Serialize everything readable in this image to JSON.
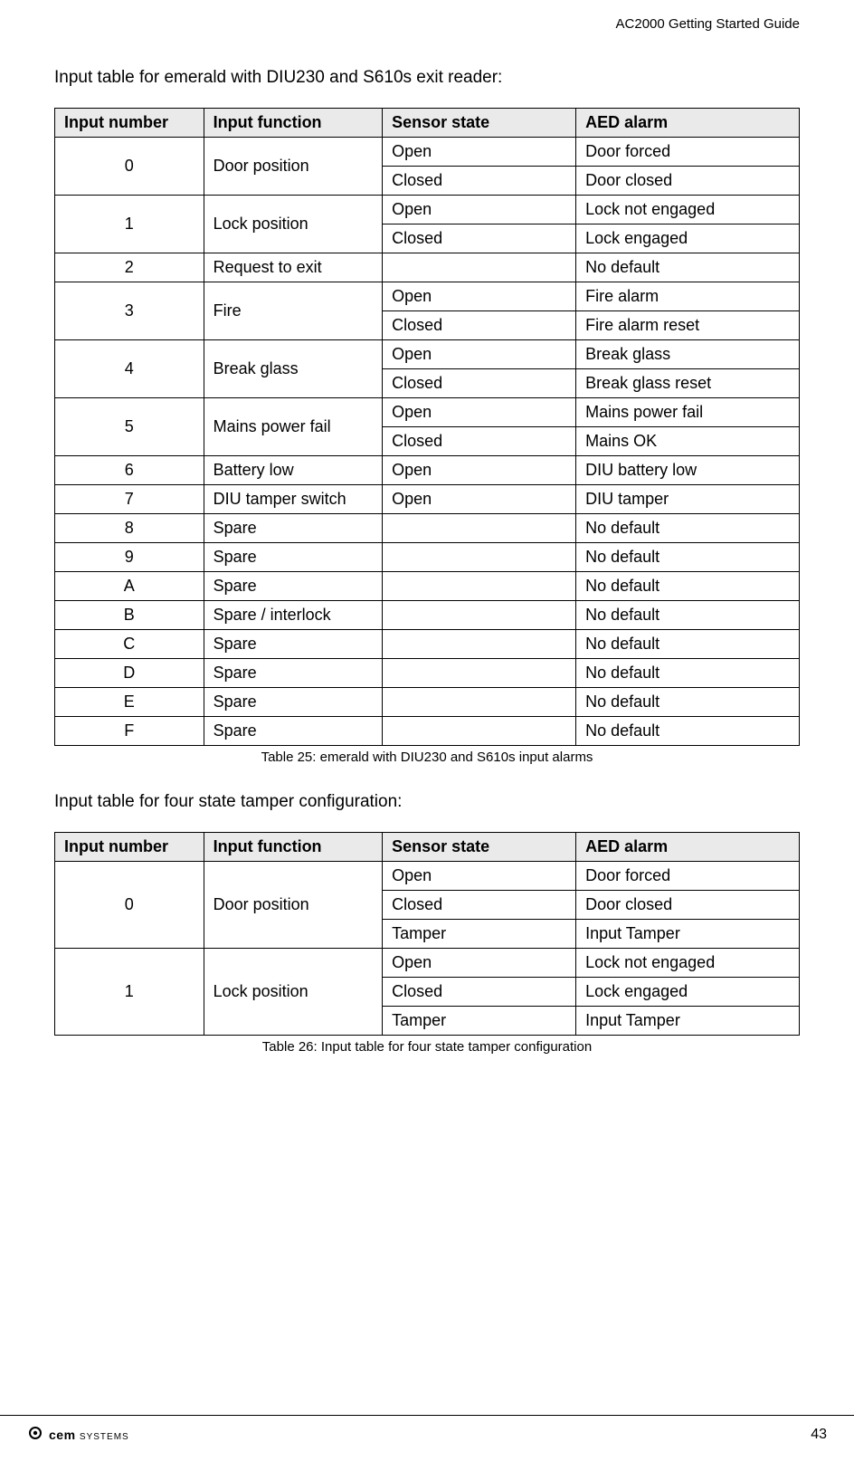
{
  "header": {
    "doc_title": "AC2000 Getting Started Guide"
  },
  "section1": {
    "intro": "Input table for emerald with DIU230 and S610s exit reader:",
    "headers": [
      "Input number",
      "Input function",
      "Sensor state",
      "AED alarm"
    ],
    "rows": [
      {
        "num": "0",
        "func": "Door position",
        "states": [
          [
            "Open",
            "Door forced"
          ],
          [
            "Closed",
            "Door closed"
          ]
        ]
      },
      {
        "num": "1",
        "func": "Lock position",
        "states": [
          [
            "Open",
            "Lock not engaged"
          ],
          [
            "Closed",
            "Lock engaged"
          ]
        ]
      },
      {
        "num": "2",
        "func": "Request to exit",
        "states": [
          [
            "",
            "No default"
          ]
        ]
      },
      {
        "num": "3",
        "func": "Fire",
        "states": [
          [
            "Open",
            "Fire alarm"
          ],
          [
            "Closed",
            "Fire alarm reset"
          ]
        ]
      },
      {
        "num": "4",
        "func": "Break glass",
        "states": [
          [
            "Open",
            "Break glass"
          ],
          [
            "Closed",
            "Break glass reset"
          ]
        ]
      },
      {
        "num": "5",
        "func": "Mains power fail",
        "states": [
          [
            "Open",
            "Mains power fail"
          ],
          [
            "Closed",
            "Mains OK"
          ]
        ]
      },
      {
        "num": "6",
        "func": "Battery low",
        "states": [
          [
            "Open",
            "DIU battery low"
          ]
        ]
      },
      {
        "num": "7",
        "func": "DIU tamper switch",
        "states": [
          [
            "Open",
            "DIU tamper"
          ]
        ]
      },
      {
        "num": "8",
        "func": "Spare",
        "states": [
          [
            "",
            "No default"
          ]
        ]
      },
      {
        "num": "9",
        "func": "Spare",
        "states": [
          [
            "",
            "No default"
          ]
        ]
      },
      {
        "num": "A",
        "func": "Spare",
        "states": [
          [
            "",
            "No default"
          ]
        ]
      },
      {
        "num": "B",
        "func": "Spare / interlock",
        "states": [
          [
            "",
            "No default"
          ]
        ]
      },
      {
        "num": "C",
        "func": "Spare",
        "states": [
          [
            "",
            "No default"
          ]
        ]
      },
      {
        "num": "D",
        "func": "Spare",
        "states": [
          [
            "",
            "No default"
          ]
        ]
      },
      {
        "num": "E",
        "func": "Spare",
        "states": [
          [
            "",
            "No default"
          ]
        ]
      },
      {
        "num": "F",
        "func": "Spare",
        "states": [
          [
            "",
            "No default"
          ]
        ]
      }
    ],
    "caption": "Table 25: emerald with DIU230 and S610s input alarms"
  },
  "section2": {
    "intro": "Input table for four state tamper configuration:",
    "headers": [
      "Input number",
      "Input function",
      "Sensor state",
      "AED alarm"
    ],
    "rows": [
      {
        "num": "0",
        "func": "Door position",
        "states": [
          [
            "Open",
            "Door forced"
          ],
          [
            "Closed",
            "Door closed"
          ],
          [
            "Tamper",
            "Input Tamper"
          ]
        ]
      },
      {
        "num": "1",
        "func": "Lock position",
        "states": [
          [
            "Open",
            "Lock not engaged"
          ],
          [
            "Closed",
            "Lock engaged"
          ],
          [
            "Tamper",
            "Input Tamper"
          ]
        ]
      }
    ],
    "caption": "Table 26: Input table for four state tamper configuration"
  },
  "footer": {
    "logo_text": "cem",
    "logo_sub": "SYSTEMS",
    "page_number": "43"
  },
  "chart_data": [
    {
      "type": "table",
      "title": "Input table for emerald with DIU230 and S610s exit reader",
      "columns": [
        "Input number",
        "Input function",
        "Sensor state",
        "AED alarm"
      ],
      "data": [
        [
          "0",
          "Door position",
          "Open",
          "Door forced"
        ],
        [
          "0",
          "Door position",
          "Closed",
          "Door closed"
        ],
        [
          "1",
          "Lock position",
          "Open",
          "Lock not engaged"
        ],
        [
          "1",
          "Lock position",
          "Closed",
          "Lock engaged"
        ],
        [
          "2",
          "Request to exit",
          "",
          "No default"
        ],
        [
          "3",
          "Fire",
          "Open",
          "Fire alarm"
        ],
        [
          "3",
          "Fire",
          "Closed",
          "Fire alarm reset"
        ],
        [
          "4",
          "Break glass",
          "Open",
          "Break glass"
        ],
        [
          "4",
          "Break glass",
          "Closed",
          "Break glass reset"
        ],
        [
          "5",
          "Mains power fail",
          "Open",
          "Mains power fail"
        ],
        [
          "5",
          "Mains power fail",
          "Closed",
          "Mains OK"
        ],
        [
          "6",
          "Battery low",
          "Open",
          "DIU battery low"
        ],
        [
          "7",
          "DIU tamper switch",
          "Open",
          "DIU tamper"
        ],
        [
          "8",
          "Spare",
          "",
          "No default"
        ],
        [
          "9",
          "Spare",
          "",
          "No default"
        ],
        [
          "A",
          "Spare",
          "",
          "No default"
        ],
        [
          "B",
          "Spare / interlock",
          "",
          "No default"
        ],
        [
          "C",
          "Spare",
          "",
          "No default"
        ],
        [
          "D",
          "Spare",
          "",
          "No default"
        ],
        [
          "E",
          "Spare",
          "",
          "No default"
        ],
        [
          "F",
          "Spare",
          "",
          "No default"
        ]
      ]
    },
    {
      "type": "table",
      "title": "Input table for four state tamper configuration",
      "columns": [
        "Input number",
        "Input function",
        "Sensor state",
        "AED alarm"
      ],
      "data": [
        [
          "0",
          "Door position",
          "Open",
          "Door forced"
        ],
        [
          "0",
          "Door position",
          "Closed",
          "Door closed"
        ],
        [
          "0",
          "Door position",
          "Tamper",
          "Input Tamper"
        ],
        [
          "1",
          "Lock position",
          "Open",
          "Lock not engaged"
        ],
        [
          "1",
          "Lock position",
          "Closed",
          "Lock engaged"
        ],
        [
          "1",
          "Lock position",
          "Tamper",
          "Input Tamper"
        ]
      ]
    }
  ]
}
